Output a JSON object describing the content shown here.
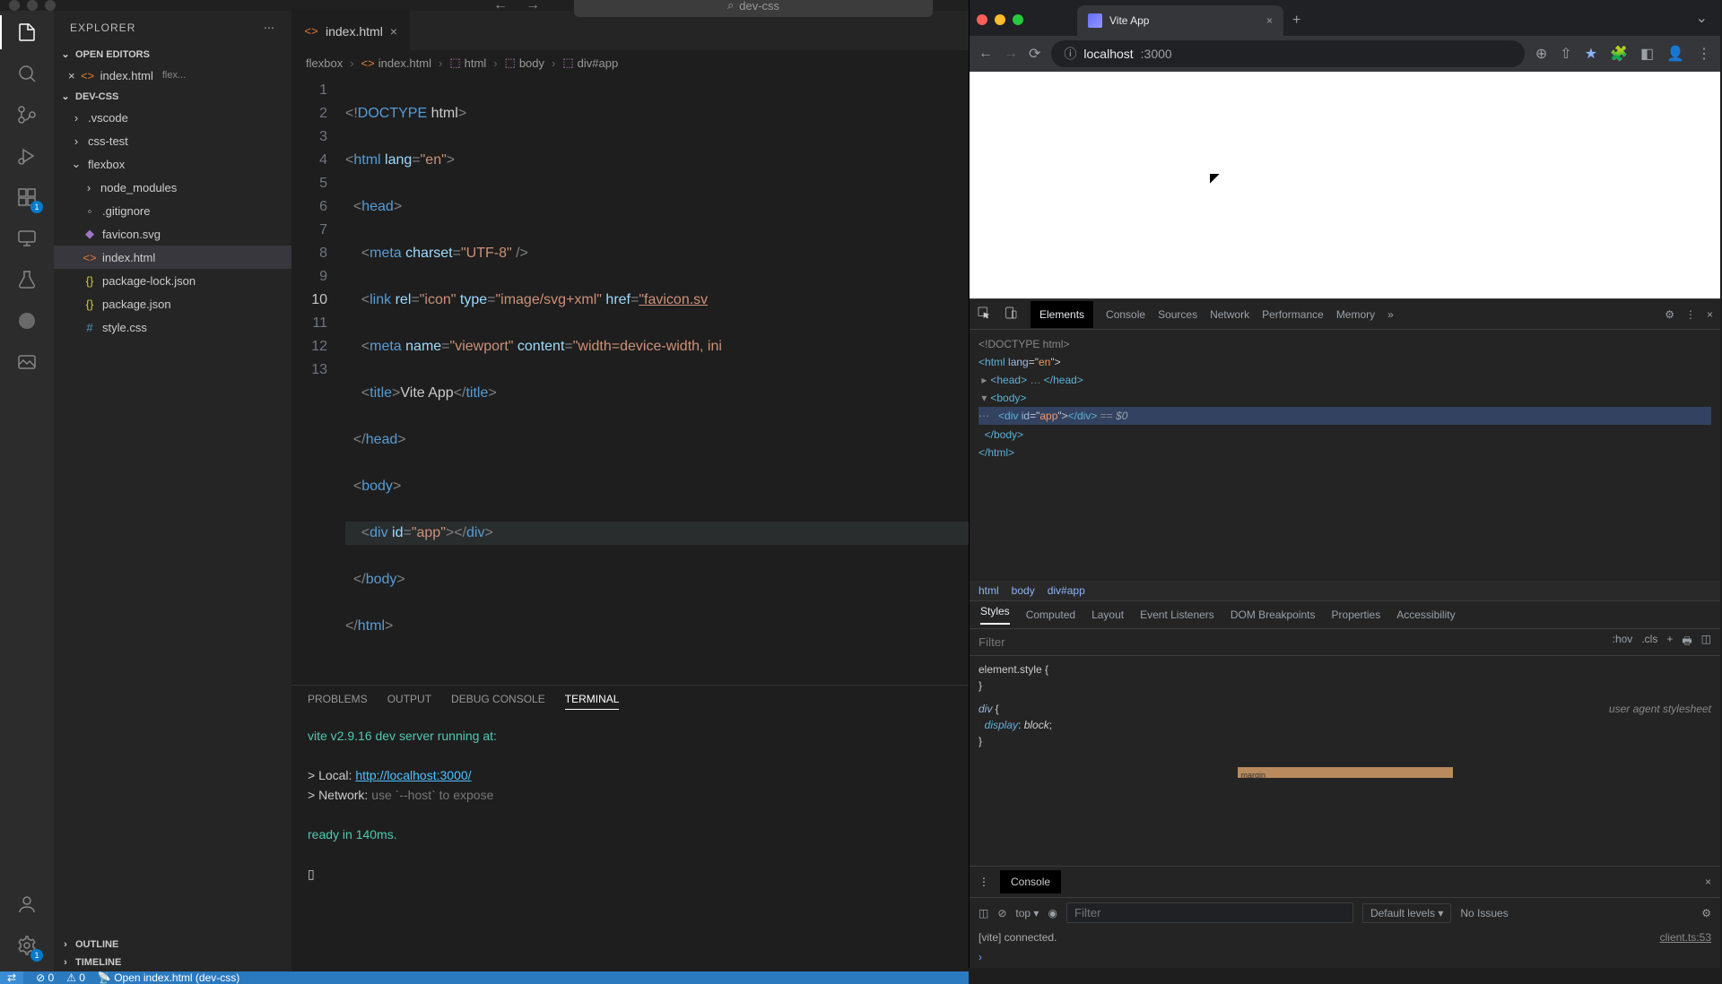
{
  "vscode": {
    "search": "dev-css",
    "explorer": {
      "title": "EXPLORER",
      "openEditors": "OPEN EDITORS",
      "project": "DEV-CSS",
      "openFile": "index.html",
      "openFileDesc": "flex...",
      "tree": {
        "vscode": ".vscode",
        "cssTest": "css-test",
        "flexbox": "flexbox",
        "nodeModules": "node_modules",
        "gitignore": ".gitignore",
        "favicon": "favicon.svg",
        "index": "index.html",
        "pkgLock": "package-lock.json",
        "pkg": "package.json",
        "style": "style.css"
      },
      "outline": "OUTLINE",
      "timeline": "TIMELINE"
    },
    "badge": "1",
    "tab": {
      "name": "index.html"
    },
    "breadcrumb": {
      "p1": "flexbox",
      "p2": "index.html",
      "p3": "html",
      "p4": "body",
      "p5": "div#app"
    },
    "code": {
      "l1a": "<!",
      "l1b": "DOCTYPE",
      "l1c": " html",
      "l1d": ">",
      "l2a": "<",
      "l2b": "html",
      "l2c": " lang",
      "l2d": "=",
      "l2e": "\"en\"",
      "l2f": ">",
      "l3a": "<",
      "l3b": "head",
      "l3c": ">",
      "l4a": "<",
      "l4b": "meta",
      "l4c": " charset",
      "l4d": "=",
      "l4e": "\"UTF-8\"",
      "l4f": " />",
      "l5a": "<",
      "l5b": "link",
      "l5c": " rel",
      "l5d": "=",
      "l5e": "\"icon\"",
      "l5f": " type",
      "l5g": "=",
      "l5h": "\"image/svg+xml\"",
      "l5i": " href",
      "l5j": "=",
      "l5k": "\"favicon.sv",
      "l6a": "<",
      "l6b": "meta",
      "l6c": " name",
      "l6d": "=",
      "l6e": "\"viewport\"",
      "l6f": " content",
      "l6g": "=",
      "l6h": "\"width=device-width, ini",
      "l7a": "<",
      "l7b": "title",
      "l7c": ">",
      "l7d": "Vite App",
      "l7e": "</",
      "l7f": "title",
      "l7g": ">",
      "l8a": "</",
      "l8b": "head",
      "l8c": ">",
      "l9a": "<",
      "l9b": "body",
      "l9c": ">",
      "l10a": "<",
      "l10b": "div",
      "l10c": " id",
      "l10d": "=",
      "l10e": "\"app\"",
      "l10f": "></",
      "l10g": "div",
      "l10h": ">",
      "l11a": "</",
      "l11b": "body",
      "l11c": ">",
      "l12a": "</",
      "l12b": "html",
      "l12c": ">"
    },
    "lineNums": {
      "n1": "1",
      "n2": "2",
      "n3": "3",
      "n4": "4",
      "n5": "5",
      "n6": "6",
      "n7": "7",
      "n8": "8",
      "n9": "9",
      "n10": "10",
      "n11": "11",
      "n12": "12",
      "n13": "13"
    },
    "panel": {
      "problems": "PROBLEMS",
      "output": "OUTPUT",
      "debug": "DEBUG CONSOLE",
      "terminal": "TERMINAL"
    },
    "term": {
      "l1": "vite v2.9.16 dev server running at:",
      "l2a": "> Local:   ",
      "l2b": "http://localhost:3000/",
      "l3a": "> Network: ",
      "l3b": "use `--host` to expose",
      "l4": "ready in 140ms.",
      "prompt": "▯"
    },
    "status": {
      "errors": "0",
      "warnings": "0",
      "live": "Open index.html (dev-css)"
    }
  },
  "chrome": {
    "tab": "Vite App",
    "url": {
      "host": "localhost",
      "port": ":3000"
    },
    "devtools": {
      "tabs": {
        "elements": "Elements",
        "console": "Console",
        "sources": "Sources",
        "network": "Network",
        "performance": "Performance",
        "memory": "Memory"
      },
      "dom": {
        "l1": "<!DOCTYPE html>",
        "l2a": "<",
        "l2b": "html",
        "l2c": " lang",
        "l2d": "=\"",
        "l2e": "en",
        "l2f": "\">",
        "l3a": "<head>",
        "l3b": " … ",
        "l3c": "</head>",
        "l4": "<body>",
        "l5a": "<",
        "l5b": "div",
        "l5c": " id",
        "l5d": "=\"",
        "l5e": "app",
        "l5f": "\">",
        "l5g": "</div>",
        "l5h": " == ",
        "l5i": "$0",
        "l6": "</body>",
        "l7": "</html>"
      },
      "bc": {
        "html": "html",
        "body": "body",
        "app": "div#app"
      },
      "stylesTabs": {
        "styles": "Styles",
        "computed": "Computed",
        "layout": "Layout",
        "listeners": "Event Listeners",
        "dom": "DOM Breakpoints",
        "props": "Properties",
        "a11y": "Accessibility"
      },
      "filter": {
        "placeholder": "Filter",
        "hov": ":hov",
        "cls": ".cls"
      },
      "css": {
        "r1": "element.style {",
        "r1b": "}",
        "r2sel": "div",
        "r2open": " {",
        "r2prop": "display",
        "r2sep": ": ",
        "r2val": "block",
        "r2end": ";",
        "r2close": "}",
        "ua": "user agent stylesheet",
        "margin": "margin"
      },
      "drawer": {
        "label": "Console",
        "top": "top",
        "filter": "Filter",
        "levels": "Default levels",
        "issues": "No Issues",
        "log": "[vite] connected.",
        "logSrc": "client.ts:53",
        "prompt": "›"
      }
    }
  }
}
